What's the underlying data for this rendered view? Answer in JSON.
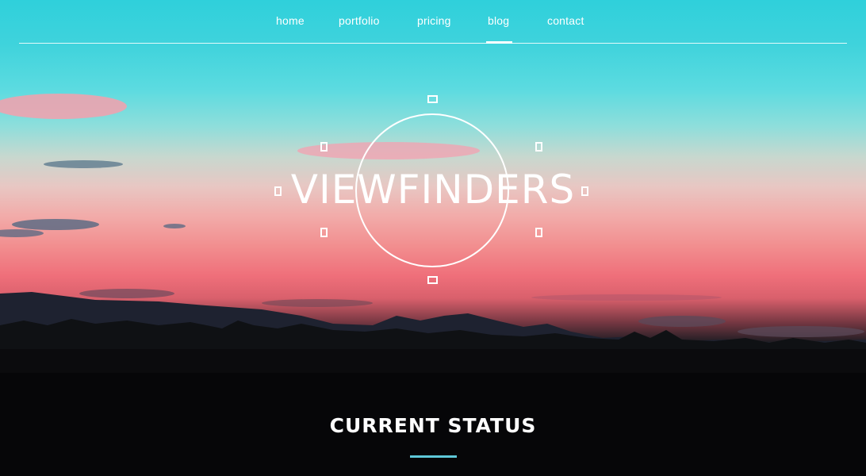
{
  "nav": {
    "items": [
      {
        "label": "home",
        "active": false
      },
      {
        "label": "portfolio",
        "active": false
      },
      {
        "label": "pricing",
        "active": false
      },
      {
        "label": "blog",
        "active": true
      },
      {
        "label": "contact",
        "active": false
      }
    ]
  },
  "hero": {
    "logo_text": "VIEWFINDERS",
    "background": "sunset sky over mountain silhouette",
    "colors": {
      "sky_top": "#2fd0db",
      "horizon": "#ef6f7a",
      "silhouette": "#0c0c0e"
    }
  },
  "section": {
    "title": "CURRENT STATUS",
    "accent_color": "#5ec8d8"
  }
}
